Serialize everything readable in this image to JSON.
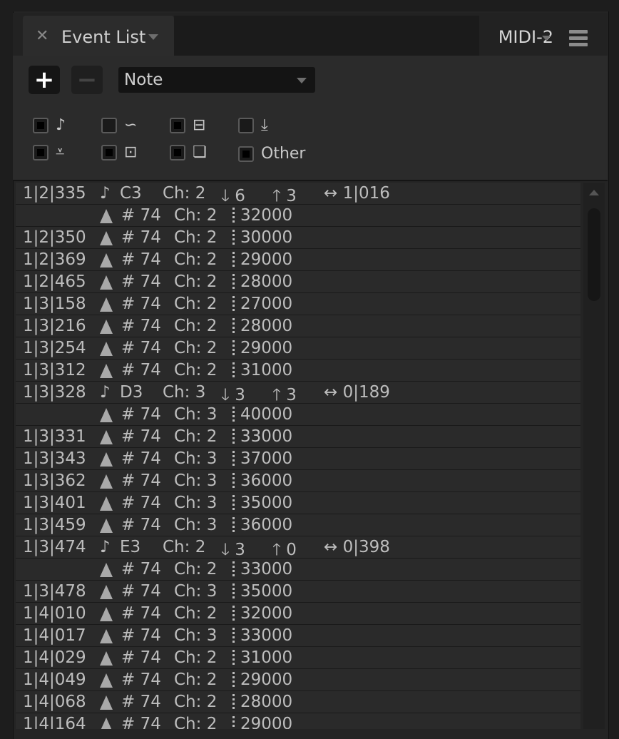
{
  "header": {
    "tab_close_icon": "close-icon",
    "tab_title": "Event List",
    "output": "MIDI-2",
    "menu_icon": "hamburger-menu-icon"
  },
  "toolbar": {
    "add_label": "+",
    "remove_label": "−",
    "type_select": "Note"
  },
  "filters": {
    "note": {
      "icon": "♪",
      "checked": true
    },
    "pitchbend": {
      "icon": "∽",
      "checked": false
    },
    "aftertouch": {
      "icon": "⊟",
      "checked": true
    },
    "sysex": {
      "icon": "⤓",
      "checked": false
    },
    "controller": {
      "icon": "⩡",
      "checked": true
    },
    "program": {
      "icon": "⊡",
      "checked": true
    },
    "poly": {
      "icon": "❏",
      "checked": true
    },
    "other": {
      "label": "Other",
      "checked": true
    }
  },
  "events": [
    {
      "type": "note",
      "time": "1|2|335",
      "note": "C3",
      "ch": "Ch: 2",
      "vel": "6",
      "off": "3",
      "len": "1|016"
    },
    {
      "type": "cc",
      "time": "",
      "ctl": "# 74",
      "ch": "Ch: 2",
      "val": "32000"
    },
    {
      "type": "cc",
      "time": "1|2|350",
      "ctl": "# 74",
      "ch": "Ch: 2",
      "val": "30000"
    },
    {
      "type": "cc",
      "time": "1|2|369",
      "ctl": "# 74",
      "ch": "Ch: 2",
      "val": "29000"
    },
    {
      "type": "cc",
      "time": "1|2|465",
      "ctl": "# 74",
      "ch": "Ch: 2",
      "val": "28000"
    },
    {
      "type": "cc",
      "time": "1|3|158",
      "ctl": "# 74",
      "ch": "Ch: 2",
      "val": "27000"
    },
    {
      "type": "cc",
      "time": "1|3|216",
      "ctl": "# 74",
      "ch": "Ch: 2",
      "val": "28000"
    },
    {
      "type": "cc",
      "time": "1|3|254",
      "ctl": "# 74",
      "ch": "Ch: 2",
      "val": "29000"
    },
    {
      "type": "cc",
      "time": "1|3|312",
      "ctl": "# 74",
      "ch": "Ch: 2",
      "val": "31000"
    },
    {
      "type": "note",
      "time": "1|3|328",
      "note": "D3",
      "ch": "Ch: 3",
      "vel": "3",
      "off": "3",
      "len": "0|189"
    },
    {
      "type": "cc",
      "time": "",
      "ctl": "# 74",
      "ch": "Ch: 3",
      "val": "40000"
    },
    {
      "type": "cc",
      "time": "1|3|331",
      "ctl": "# 74",
      "ch": "Ch: 2",
      "val": "33000"
    },
    {
      "type": "cc",
      "time": "1|3|343",
      "ctl": "# 74",
      "ch": "Ch: 3",
      "val": "37000"
    },
    {
      "type": "cc",
      "time": "1|3|362",
      "ctl": "# 74",
      "ch": "Ch: 3",
      "val": "36000"
    },
    {
      "type": "cc",
      "time": "1|3|401",
      "ctl": "# 74",
      "ch": "Ch: 3",
      "val": "35000"
    },
    {
      "type": "cc",
      "time": "1|3|459",
      "ctl": "# 74",
      "ch": "Ch: 3",
      "val": "36000"
    },
    {
      "type": "note",
      "time": "1|3|474",
      "note": "E3",
      "ch": "Ch: 2",
      "vel": "3",
      "off": "0",
      "len": "0|398"
    },
    {
      "type": "cc",
      "time": "",
      "ctl": "# 74",
      "ch": "Ch: 2",
      "val": "33000"
    },
    {
      "type": "cc",
      "time": "1|3|478",
      "ctl": "# 74",
      "ch": "Ch: 3",
      "val": "35000"
    },
    {
      "type": "cc",
      "time": "1|4|010",
      "ctl": "# 74",
      "ch": "Ch: 2",
      "val": "32000"
    },
    {
      "type": "cc",
      "time": "1|4|017",
      "ctl": "# 74",
      "ch": "Ch: 3",
      "val": "33000"
    },
    {
      "type": "cc",
      "time": "1|4|029",
      "ctl": "# 74",
      "ch": "Ch: 2",
      "val": "31000"
    },
    {
      "type": "cc",
      "time": "1|4|049",
      "ctl": "# 74",
      "ch": "Ch: 2",
      "val": "29000"
    },
    {
      "type": "cc",
      "time": "1|4|068",
      "ctl": "# 74",
      "ch": "Ch: 2",
      "val": "28000"
    },
    {
      "type": "cc",
      "time": "1|4|164",
      "ctl": "# 74",
      "ch": "Ch: 2",
      "val": "29000"
    }
  ]
}
